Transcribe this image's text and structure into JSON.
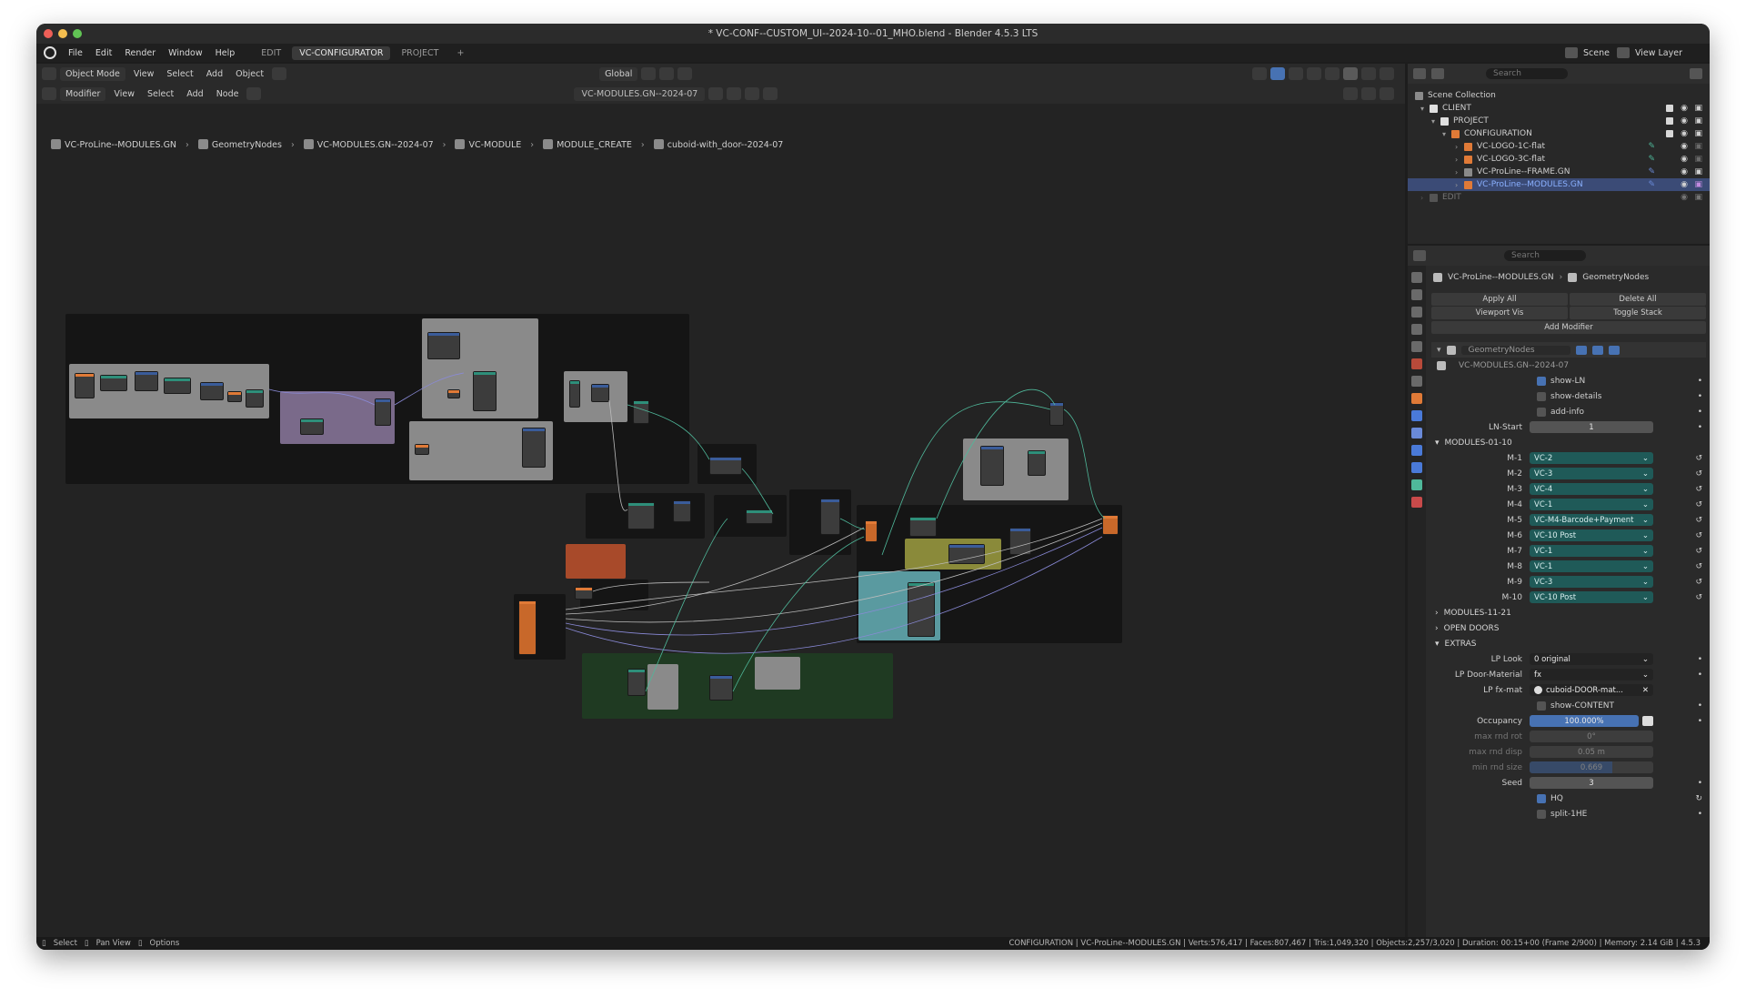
{
  "window": {
    "title": "* VC-CONF--CUSTOM_UI--2024-10--01_MHO.blend - Blender 4.5.3 LTS"
  },
  "menu": {
    "items": [
      "File",
      "Edit",
      "Render",
      "Window",
      "Help"
    ],
    "workspaces": [
      "EDIT",
      "VC-CONFIGURATOR",
      "PROJECT"
    ],
    "add_workspace": "+"
  },
  "viewport_header": {
    "mode": "Object Mode",
    "items": [
      "View",
      "Select",
      "Add",
      "Object"
    ],
    "transform": "Global"
  },
  "node_header": {
    "editor": "Modifier",
    "items": [
      "View",
      "Select",
      "Add",
      "Node"
    ],
    "node_tree": "VC-MODULES.GN--2024-07"
  },
  "breadcrumb": [
    "VC-ProLine--MODULES.GN",
    "GeometryNodes",
    "VC-MODULES.GN--2024-07",
    "VC-MODULE",
    "MODULE_CREATE",
    "cuboid-with_door--2024-07"
  ],
  "scene": {
    "scene_label": "Scene",
    "view_layer_label": "View Layer"
  },
  "outliner": {
    "search_placeholder": "Search",
    "rows": [
      {
        "label": "Scene Collection",
        "indent": 0
      },
      {
        "label": "CLIENT",
        "indent": 1
      },
      {
        "label": "PROJECT",
        "indent": 2
      },
      {
        "label": "CONFIGURATION",
        "indent": 3
      },
      {
        "label": "VC-LOGO-1C-flat",
        "indent": 4
      },
      {
        "label": "VC-LOGO-3C-flat",
        "indent": 4
      },
      {
        "label": "VC-ProLine--FRAME.GN",
        "indent": 4
      },
      {
        "label": "VC-ProLine--MODULES.GN",
        "indent": 4,
        "selected": true
      },
      {
        "label": "EDIT",
        "indent": 1,
        "dim": true
      }
    ]
  },
  "properties": {
    "search_placeholder": "Search",
    "object": "VC-ProLine--MODULES.GN",
    "modifier_name": "GeometryNodes",
    "apply_all": "Apply All",
    "delete_all": "Delete All",
    "viewport_vis": "Viewport Vis",
    "toggle_stack": "Toggle Stack",
    "add_modifier": "Add Modifier",
    "modifier_title": "GeometryNodes",
    "node_group": "VC-MODULES.GN--2024-07",
    "show_ln": "show-LN",
    "show_details": "show-details",
    "add_info": "add-info",
    "ln_start_label": "LN-Start",
    "ln_start_value": "1",
    "section_modules_1": "MODULES-01-10",
    "modules": [
      {
        "label": "M-1",
        "value": "VC-2"
      },
      {
        "label": "M-2",
        "value": "VC-3"
      },
      {
        "label": "M-3",
        "value": "VC-4"
      },
      {
        "label": "M-4",
        "value": "VC-1"
      },
      {
        "label": "M-5",
        "value": "VC-M4-Barcode+Payment"
      },
      {
        "label": "M-6",
        "value": "VC-10 Post"
      },
      {
        "label": "M-7",
        "value": "VC-1"
      },
      {
        "label": "M-8",
        "value": "VC-1"
      },
      {
        "label": "M-9",
        "value": "VC-3"
      },
      {
        "label": "M-10",
        "value": "VC-10 Post"
      }
    ],
    "section_modules_2": "MODULES-11-21",
    "section_open_doors": "OPEN DOORS",
    "section_extras": "EXTRAS",
    "lp_look_label": "LP Look",
    "lp_look_value": "0 original",
    "lp_door_label": "LP Door-Material",
    "lp_door_value": "fx",
    "lp_fx_label": "LP fx-mat",
    "lp_fx_value": "cuboid-DOOR-mat...",
    "show_content": "show-CONTENT",
    "occupancy_label": "Occupancy",
    "occupancy_value": "100.000%",
    "max_rnd_rot_label": "max rnd rot",
    "max_rnd_rot_value": "0°",
    "max_rnd_disp_label": "max rnd disp",
    "max_rnd_disp_value": "0.05 m",
    "min_rnd_size_label": "min rnd size",
    "min_rnd_size_value": "0.669",
    "seed_label": "Seed",
    "seed_value": "3",
    "hq": "HQ",
    "split": "split-1HE"
  },
  "statusbar": {
    "select": "Select",
    "pan": "Pan View",
    "options": "Options",
    "info": "CONFIGURATION | VC-ProLine--MODULES.GN | Verts:576,417 | Faces:807,467 | Tris:1,049,320 | Objects:2,257/3,020 | Duration: 00:15+00 (Frame 2/900) | Memory: 2.14 GiB | 4.5.3"
  },
  "colors": {
    "accent": "#4772b3",
    "teal_field": "#1f5a58",
    "node_orange": "#e07a37",
    "frame_purple": "#7a6a8a",
    "frame_olive": "#8a8a3a",
    "frame_teal": "#5a9aa0",
    "frame_green": "#1f3a22",
    "frame_red": "#a84a2a"
  }
}
